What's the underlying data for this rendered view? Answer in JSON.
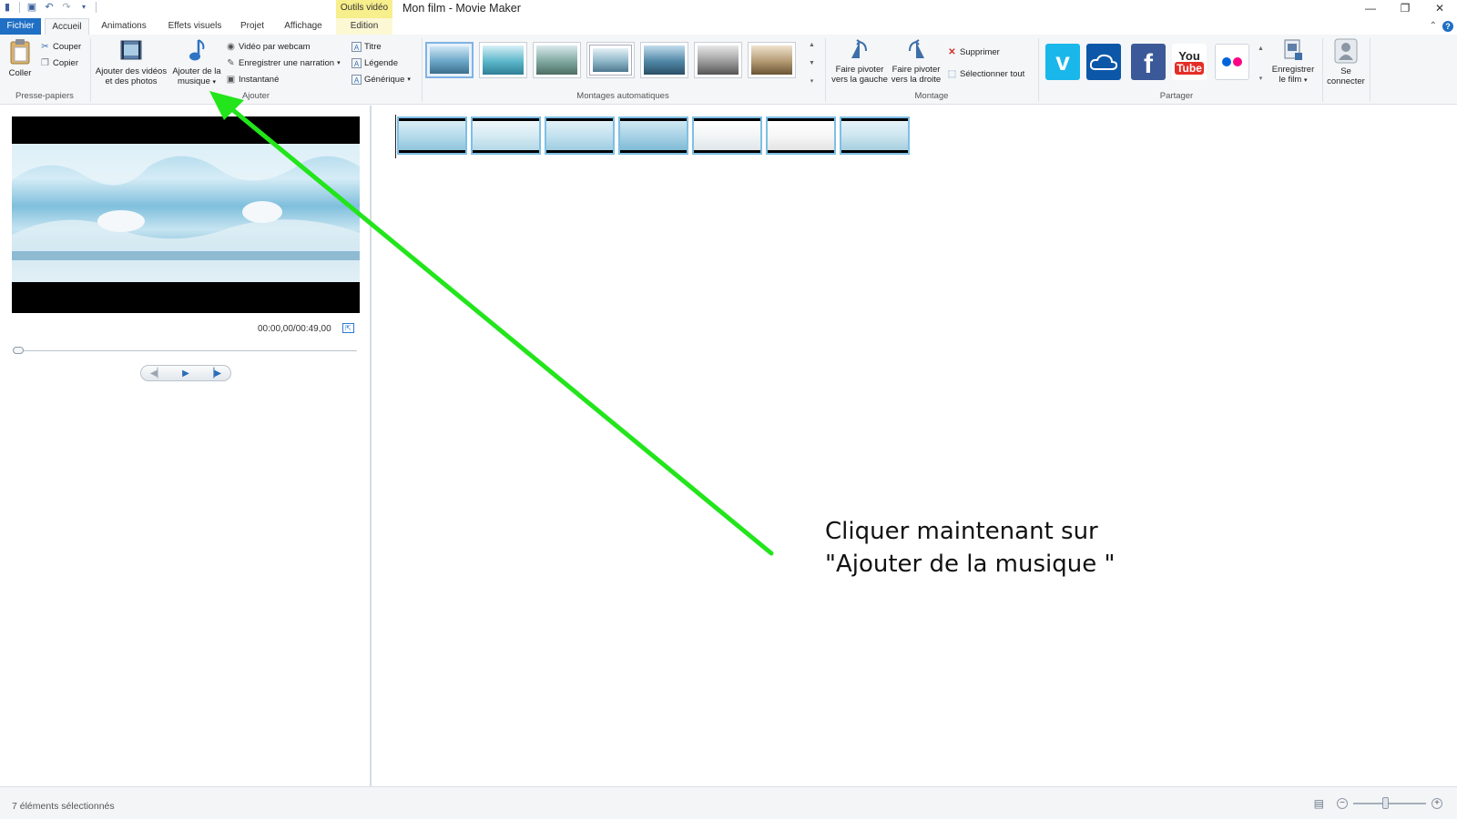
{
  "window": {
    "title": "Mon film - Movie Maker",
    "context_tab_header": "Outils vidéo"
  },
  "tabs": [
    {
      "label": "Fichier"
    },
    {
      "label": "Accueil"
    },
    {
      "label": "Animations"
    },
    {
      "label": "Effets visuels"
    },
    {
      "label": "Projet"
    },
    {
      "label": "Affichage"
    },
    {
      "label": "Edition"
    }
  ],
  "ribbon": {
    "clipboard": {
      "paste": "Coller",
      "cut": "Couper",
      "copy": "Copier",
      "group_label": "Presse-papiers"
    },
    "add": {
      "add_videos_line1": "Ajouter des vidéos",
      "add_videos_line2": "et des photos",
      "add_music_line1": "Ajouter de la",
      "add_music_line2": "musique",
      "webcam": "Vidéo par webcam",
      "narration": "Enregistrer une narration",
      "snapshot": "Instantané",
      "title": "Titre",
      "caption": "Légende",
      "credits": "Générique",
      "group_label": "Ajouter"
    },
    "automovies": {
      "group_label": "Montages automatiques",
      "themes": [
        {
          "name": "theme-1",
          "color": "#6aa6c8"
        },
        {
          "name": "theme-2",
          "color": "#5bb6c9"
        },
        {
          "name": "theme-3",
          "color": "#7fa8a0"
        },
        {
          "name": "theme-4",
          "color": "#8fb7c9"
        },
        {
          "name": "theme-5",
          "color": "#4f86a6"
        },
        {
          "name": "theme-6",
          "color": "#9c9c9c"
        },
        {
          "name": "theme-7",
          "color": "#b39a72"
        }
      ]
    },
    "editing": {
      "rotate_left_line1": "Faire pivoter",
      "rotate_left_line2": "vers la gauche",
      "rotate_right_line1": "Faire pivoter",
      "rotate_right_line2": "vers la droite",
      "delete": "Supprimer",
      "select_all": "Sélectionner tout",
      "group_label": "Montage"
    },
    "share": {
      "group_label": "Partager",
      "save_movie_line1": "Enregistrer",
      "save_movie_line2": "le film",
      "sign_in_line1": "Se",
      "sign_in_line2": "connecter",
      "youtube_line1": "You",
      "youtube_line2": "Tube"
    }
  },
  "preview": {
    "time": "00:00,00/00:49,00"
  },
  "storyboard": {
    "clips": [
      {
        "name": "clip-1",
        "color": "#b7dcec"
      },
      {
        "name": "clip-2",
        "color": "#d6ebf3"
      },
      {
        "name": "clip-3",
        "color": "#c3e2ef"
      },
      {
        "name": "clip-4",
        "color": "#a9d3e6"
      },
      {
        "name": "clip-5",
        "color": "#f2f5f6"
      },
      {
        "name": "clip-6",
        "color": "#f7f7f7"
      },
      {
        "name": "clip-7",
        "color": "#cde6f0"
      }
    ]
  },
  "status": {
    "selection": "7 éléments sélectionnés"
  },
  "annotation": {
    "line1": "Cliquer maintenant sur",
    "line2": "\"Ajouter de la musique \"",
    "arrow_color": "#22e51b"
  },
  "colors": {
    "accent": "#1f6fc5",
    "context_tab": "#f7ee8c"
  }
}
